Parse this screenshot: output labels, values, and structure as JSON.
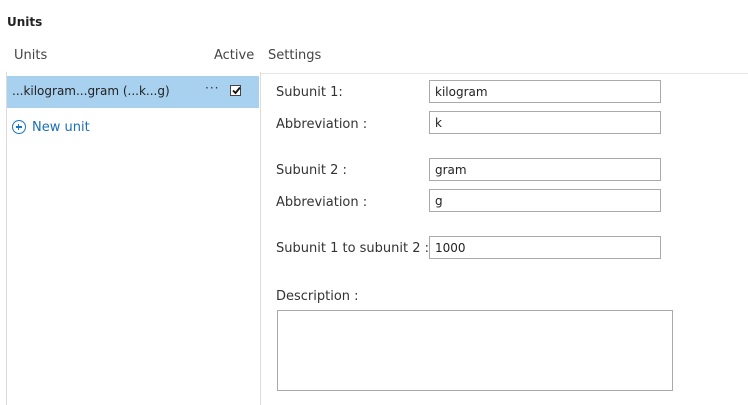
{
  "panel": {
    "title": "Units"
  },
  "headers": {
    "units": "Units",
    "active": "Active",
    "settings": "Settings"
  },
  "unit_list": [
    {
      "label": "...kilogram...gram (...k...g)",
      "more": "···",
      "active": true
    }
  ],
  "new_unit": {
    "label": "New unit",
    "icon": "plus-circle-icon"
  },
  "settings": {
    "subunit1_label": "Subunit 1:",
    "subunit1_value": "kilogram",
    "abbrev1_label": "Abbreviation :",
    "abbrev1_value": "k",
    "subunit2_label": "Subunit 2 :",
    "subunit2_value": "gram",
    "abbrev2_label": "Abbreviation :",
    "abbrev2_value": "g",
    "ratio_label": "Subunit 1 to subunit 2 :",
    "ratio_value": "1000",
    "description_label": "Description :",
    "description_value": ""
  },
  "colors": {
    "selected_row": "#a8d1ef",
    "link": "#1a6fb5"
  }
}
